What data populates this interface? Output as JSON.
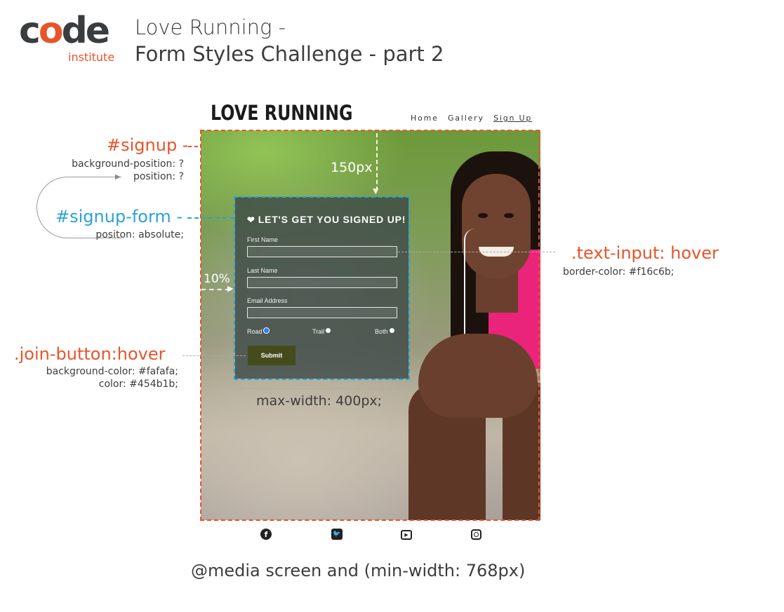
{
  "header": {
    "logo_code": "code",
    "logo_institute": "institute",
    "title_line1": "Love Running -",
    "title_line2": "Form Styles Challenge - part 2"
  },
  "site": {
    "brand": "LOVE RUNNING",
    "nav": [
      {
        "label": "Home",
        "active": false
      },
      {
        "label": "Gallery",
        "active": false
      },
      {
        "label": "Sign Up",
        "active": true
      }
    ]
  },
  "form": {
    "heading": "LET'S GET YOU SIGNED UP!",
    "heading_icon": "heartbeat-icon",
    "fields": [
      {
        "label": "First Name",
        "value": ""
      },
      {
        "label": "Last Name",
        "value": ""
      },
      {
        "label": "Email Address",
        "value": ""
      }
    ],
    "radios": [
      {
        "label": "Road",
        "selected": true
      },
      {
        "label": "Trail",
        "selected": false
      },
      {
        "label": "Both",
        "selected": false
      }
    ],
    "submit_label": "Submit"
  },
  "footer": {
    "icons": [
      "facebook-icon",
      "twitter-icon",
      "youtube-icon",
      "instagram-icon"
    ],
    "media_query": "@media screen and (min-width: 768px)"
  },
  "annotations": {
    "signup_label": "#signup -",
    "signup_bg_position": "background-position: ?",
    "signup_position": "position: ?",
    "signup_form_label": "#signup-form -",
    "signup_form_position": "positon: absolute;",
    "top_offset": "150px",
    "left_offset": "10%",
    "max_width": "max-width: 400px;",
    "text_input_label": ".text-input: hover",
    "text_input_border": "border-color: #f16c6b;",
    "join_button_label": ".join-button:hover",
    "join_button_bg": "background-color: #fafafa;",
    "join_button_color": "color: #454b1b;"
  },
  "colors": {
    "accent_orange": "#e8542a",
    "accent_blue": "#2aa3d6",
    "button_bg": "#454b1b"
  }
}
